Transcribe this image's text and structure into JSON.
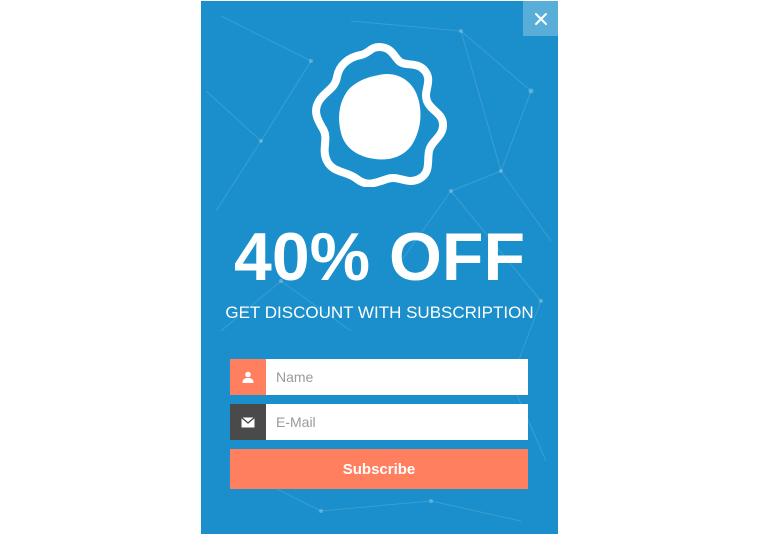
{
  "popup": {
    "headline": "40% OFF",
    "subheadline": "GET DISCOUNT WITH SUBSCRIPTION",
    "close_icon": "close-icon",
    "logo_icon": "gear-icon",
    "background_color": "#1a8fcb",
    "accent_color": "#ff7f5f"
  },
  "form": {
    "name_placeholder": "Name",
    "name_icon": "user-icon",
    "email_placeholder": "E-Mail",
    "email_icon": "envelope-icon",
    "subscribe_label": "Subscribe"
  }
}
